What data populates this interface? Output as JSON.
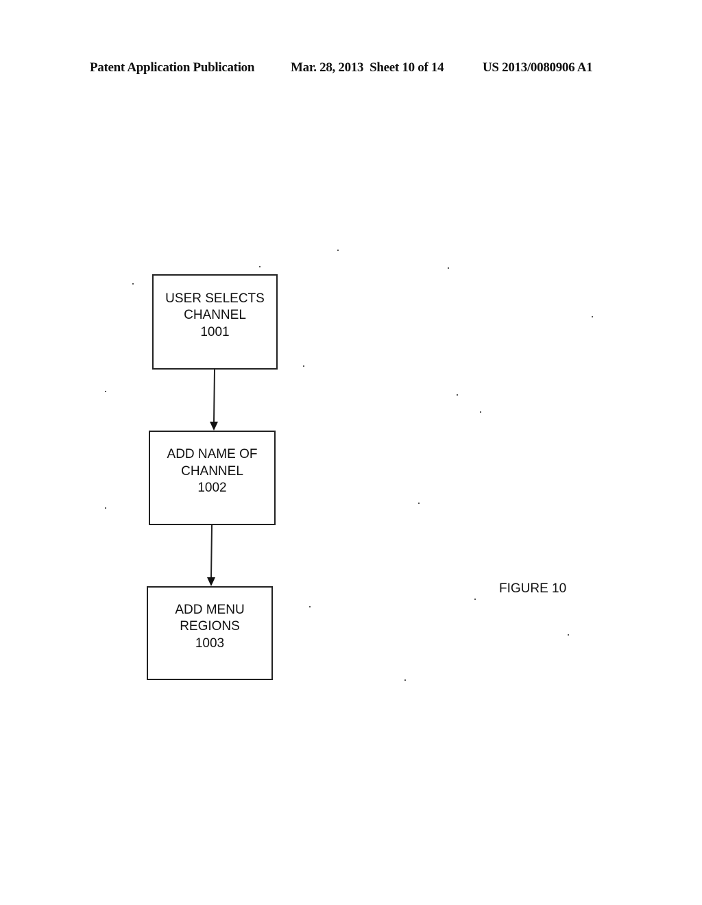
{
  "header": {
    "publication_type": "Patent Application Publication",
    "date_sheet": "Mar. 28, 2013  Sheet 10 of 14",
    "publication_number": "US 2013/0080906 A1"
  },
  "figure": {
    "label": "FIGURE 10",
    "steps": [
      {
        "lines": [
          "USER SELECTS",
          "CHANNEL",
          "1001"
        ],
        "ref": "1001"
      },
      {
        "lines": [
          "ADD NAME OF",
          "CHANNEL",
          "1002"
        ],
        "ref": "1002"
      },
      {
        "lines": [
          "ADD MENU",
          "REGIONS",
          "1003"
        ],
        "ref": "1003"
      }
    ],
    "connections": [
      {
        "from": "1001",
        "to": "1002"
      },
      {
        "from": "1002",
        "to": "1003"
      }
    ]
  }
}
